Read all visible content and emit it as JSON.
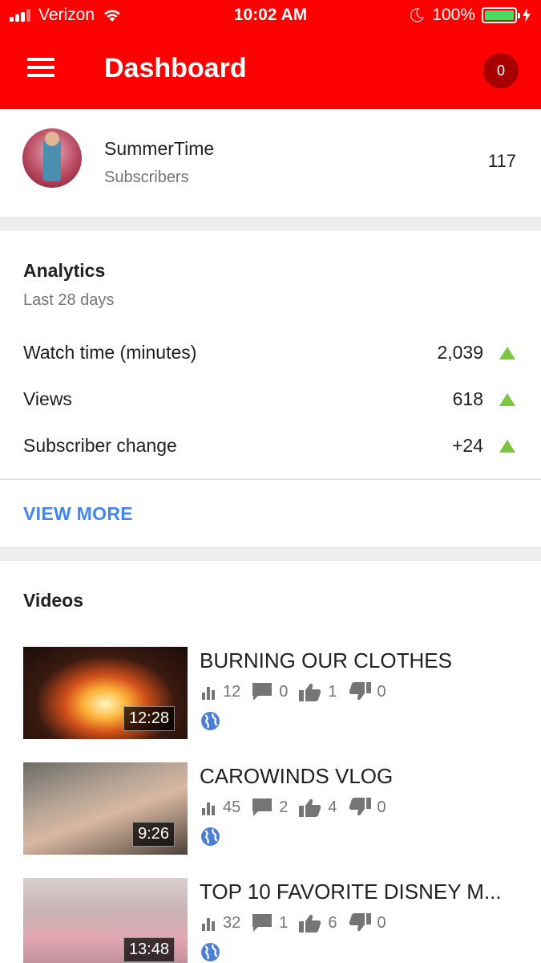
{
  "status_bar": {
    "carrier": "Verizon",
    "time": "10:02 AM",
    "battery": "100%"
  },
  "app_bar": {
    "title": "Dashboard",
    "notification_count": "0"
  },
  "channel": {
    "name": "SummerTime",
    "subscribers_label": "Subscribers",
    "subscribers_count": "117"
  },
  "analytics": {
    "title": "Analytics",
    "period": "Last 28 days",
    "metrics": [
      {
        "label": "Watch time (minutes)",
        "value": "2,039",
        "trend": "up"
      },
      {
        "label": "Views",
        "value": "618",
        "trend": "up"
      },
      {
        "label": "Subscriber change",
        "value": "+24",
        "trend": "up"
      }
    ],
    "view_more": "VIEW MORE"
  },
  "videos": {
    "title": "Videos",
    "items": [
      {
        "title": "BURNING OUR CLOTHES",
        "duration": "12:28",
        "views": "12",
        "comments": "0",
        "likes": "1",
        "dislikes": "0",
        "visibility": "public"
      },
      {
        "title": "CAROWINDS VLOG",
        "duration": "9:26",
        "views": "45",
        "comments": "2",
        "likes": "4",
        "dislikes": "0",
        "visibility": "public"
      },
      {
        "title": "TOP 10 FAVORITE DISNEY M...",
        "duration": "13:48",
        "views": "32",
        "comments": "1",
        "likes": "6",
        "dislikes": "0",
        "visibility": "public"
      }
    ]
  },
  "colors": {
    "brand_red": "#ff0000",
    "badge": "#a80000",
    "link_blue": "#4285f4",
    "trend_green": "#7cc63f"
  },
  "icons": {
    "menu": "hamburger-menu-icon",
    "views": "bar-chart-icon",
    "comments": "comment-icon",
    "likes": "thumbs-up-icon",
    "dislikes": "thumbs-down-icon",
    "visibility": "globe-icon",
    "trend": "triangle-up-icon"
  }
}
